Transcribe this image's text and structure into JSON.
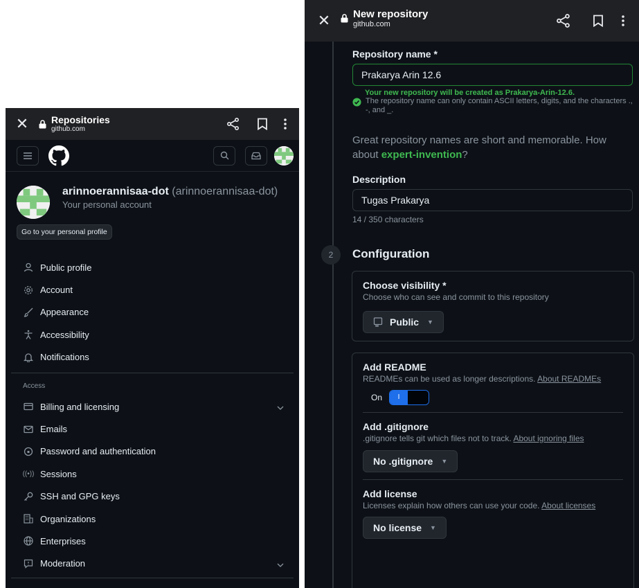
{
  "left": {
    "browser": {
      "title": "Repositories",
      "url": "github.com"
    },
    "account": {
      "username": "arinnoerannisaa-dot",
      "login_paren": "(arinnoerannisaa-dot)",
      "subtitle": "Your personal account",
      "profile_button": "Go to your personal profile"
    },
    "menu": [
      {
        "label": "Public profile",
        "icon": "person-icon"
      },
      {
        "label": "Account",
        "icon": "gear-icon"
      },
      {
        "label": "Appearance",
        "icon": "paintbrush-icon"
      },
      {
        "label": "Accessibility",
        "icon": "accessibility-icon"
      },
      {
        "label": "Notifications",
        "icon": "bell-icon"
      }
    ],
    "access_section": "Access",
    "access_menu": [
      {
        "label": "Billing and licensing",
        "icon": "credit-card-icon"
      },
      {
        "label": "Emails",
        "icon": "mail-icon"
      },
      {
        "label": "Password and authentication",
        "icon": "shield-lock-icon"
      },
      {
        "label": "Sessions",
        "icon": "broadcast-icon"
      },
      {
        "label": "SSH and GPG keys",
        "icon": "key-icon"
      },
      {
        "label": "Organizations",
        "icon": "organization-icon"
      },
      {
        "label": "Enterprises",
        "icon": "globe-icon"
      },
      {
        "label": "Moderation",
        "icon": "report-icon"
      }
    ]
  },
  "right": {
    "browser": {
      "title": "New repository",
      "url": "github.com"
    },
    "repo_name": {
      "label": "Repository name *",
      "value": "Prakarya Arin 12.6",
      "created_as": "Your new repository will be created as Prakarya-Arin-12.6.",
      "rule": "The repository name can only contain ASCII letters, digits, and the characters .,  -, and _."
    },
    "great": {
      "text_before": "Great repository names are short and memorable. How about ",
      "suggestion": "expert-invention",
      "text_after": "?"
    },
    "description": {
      "label": "Description",
      "value": "Tugas Prakarya",
      "counter": "14 / 350 characters"
    },
    "configuration": {
      "step": "2",
      "title": "Configuration"
    },
    "visibility": {
      "title": "Choose visibility *",
      "desc": "Choose who can see and commit to this repository",
      "value": "Public"
    },
    "readme": {
      "title": "Add README",
      "desc": "READMEs can be used as longer descriptions. ",
      "link": "About READMEs",
      "toggle_label": "On",
      "toggle_on_text": "I"
    },
    "gitignore": {
      "title": "Add .gitignore",
      "desc": ".gitignore tells git which files not to track. ",
      "link": "About ignoring files",
      "value": "No .gitignore"
    },
    "license": {
      "title": "Add license",
      "desc": "Licenses explain how others can use your code. ",
      "link": "About licenses",
      "value": "No license"
    }
  }
}
